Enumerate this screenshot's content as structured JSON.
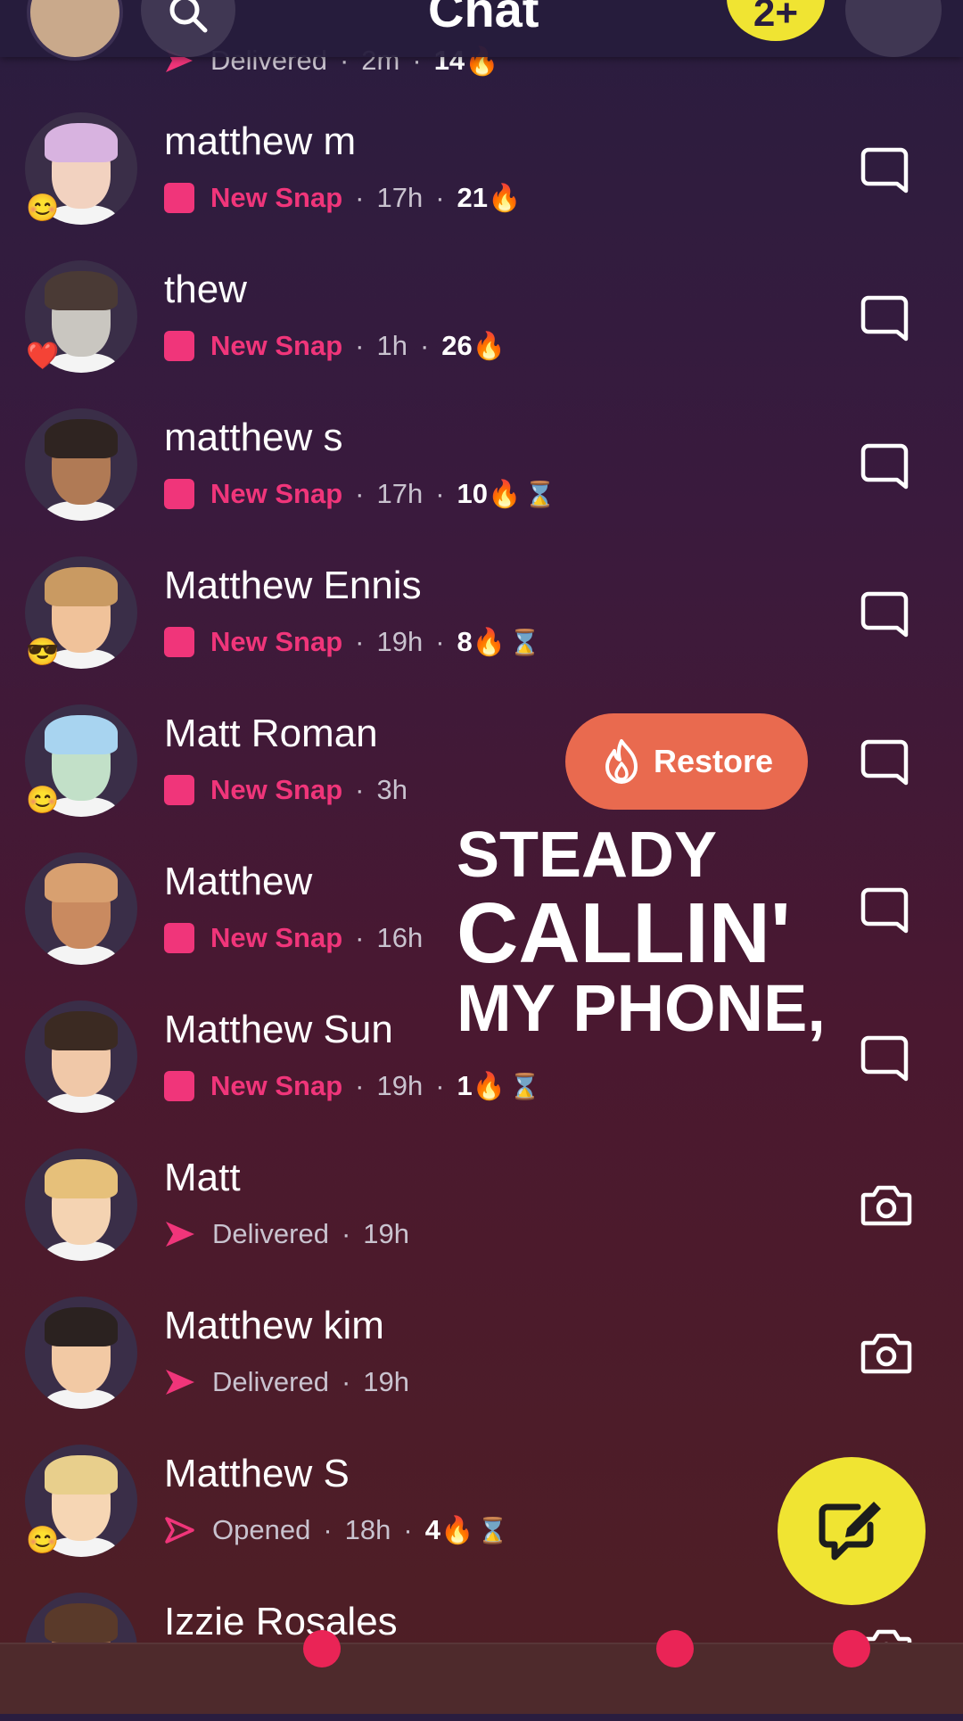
{
  "header": {
    "title": "Chat",
    "add_label": "2+"
  },
  "partial_top_row": {
    "status": "Delivered",
    "time": "2m",
    "streak": "14"
  },
  "chats": [
    {
      "name": "matthew m",
      "status": "New Snap",
      "time": "17h",
      "streak": "21",
      "hourglass": false,
      "badge": "😊",
      "action": "chat-icon"
    },
    {
      "name": "thew",
      "status": "New Snap",
      "time": "1h",
      "streak": "26",
      "hourglass": false,
      "badge": "❤️",
      "action": "chat-icon"
    },
    {
      "name": "matthew s",
      "status": "New Snap",
      "time": "17h",
      "streak": "10",
      "hourglass": true,
      "badge": "",
      "action": "chat-icon"
    },
    {
      "name": "Matthew Ennis",
      "status": "New Snap",
      "time": "19h",
      "streak": "8",
      "hourglass": true,
      "badge": "😎",
      "action": "chat-icon"
    },
    {
      "name": "Matt Roman",
      "status": "New Snap",
      "time": "3h",
      "streak": "",
      "hourglass": false,
      "badge": "😊",
      "action": "chat-icon"
    },
    {
      "name": "Matthew",
      "status": "New Snap",
      "time": "16h",
      "streak": "",
      "hourglass": false,
      "badge": "",
      "action": "chat-icon"
    },
    {
      "name": "Matthew Sun",
      "status": "New Snap",
      "time": "19h",
      "streak": "1",
      "hourglass": true,
      "badge": "",
      "action": "chat-icon"
    },
    {
      "name": "Matt",
      "status": "Delivered",
      "time": "19h",
      "streak": "",
      "hourglass": false,
      "badge": "",
      "action": "camera-icon"
    },
    {
      "name": "Matthew kim",
      "status": "Delivered",
      "time": "19h",
      "streak": "",
      "hourglass": false,
      "badge": "",
      "action": "camera-icon"
    },
    {
      "name": "Matthew S",
      "status": "Opened",
      "time": "18h",
      "streak": "4",
      "hourglass": true,
      "badge": "😊",
      "action": "chat-icon"
    },
    {
      "name": "Izzie Rosales",
      "status": "",
      "time": "",
      "streak": "",
      "hourglass": false,
      "badge": "",
      "action": "camera-icon"
    }
  ],
  "restore_label": "Restore",
  "caption": {
    "line1": "STEADY",
    "line2": "CALLIN'",
    "line3": "MY PHONE,"
  },
  "colors": {
    "accent_pink": "#f0357a",
    "yellow": "#f0e432",
    "restore": "#e96a4f"
  },
  "icons": [
    "search-icon",
    "chat-icon",
    "camera-icon",
    "fire-icon",
    "hourglass-icon",
    "new-chat-icon"
  ]
}
